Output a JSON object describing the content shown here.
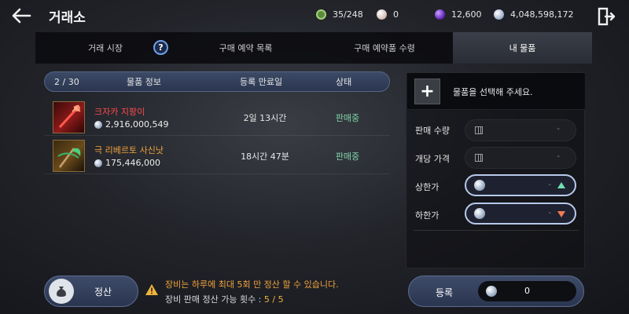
{
  "header": {
    "title": "거래소",
    "currencies": [
      {
        "icon": "bag-capacity-icon",
        "value": "35/248",
        "color": "#8fc46a"
      },
      {
        "icon": "pearl-icon",
        "value": "0",
        "color": "#e8d7d0"
      },
      {
        "icon": "purple-gem-icon",
        "value": "12,600",
        "color": "#8a4fd6"
      },
      {
        "icon": "silver-coin-icon",
        "value": "4,048,598,172",
        "color": "#c9d3e2"
      }
    ]
  },
  "tabs": [
    {
      "label": "거래 시장",
      "active": false
    },
    {
      "label": "구매 예약 목록",
      "active": false
    },
    {
      "label": "구매 예약품 수령",
      "active": false
    },
    {
      "label": "내 물품",
      "active": true
    }
  ],
  "help_icon": "?",
  "table": {
    "count": "2 / 30",
    "headers": [
      "물품 정보",
      "등록 만료일",
      "상태"
    ],
    "rows": [
      {
        "name": "크자카 지팡이",
        "name_color": "#ff4a4a",
        "price": "2,916,000,549",
        "expiry": "2일 13시간",
        "status": "판매중"
      },
      {
        "name": "극 리베르토 사신낫",
        "name_color": "#f0a23c",
        "price": "175,446,000",
        "expiry": "18시간 47분",
        "status": "판매중"
      }
    ]
  },
  "panel": {
    "select_hint": "물품을 선택해 주세요.",
    "plus": "+",
    "fields": [
      {
        "label": "판매 수량",
        "value": "-"
      },
      {
        "label": "개당 가격",
        "value": "-"
      },
      {
        "label": "상한가",
        "value": "-"
      },
      {
        "label": "하한가",
        "value": "-"
      }
    ]
  },
  "footer": {
    "settle_label": "정산",
    "notice_line1": "장비는 하루에 최대 5회 만 정산 할 수 있습니다.",
    "notice_line2_prefix": "장비 판매 정산 가능 횟수 : ",
    "notice_line2_count": "5 / 5",
    "register_label": "등록",
    "register_value": "0"
  }
}
